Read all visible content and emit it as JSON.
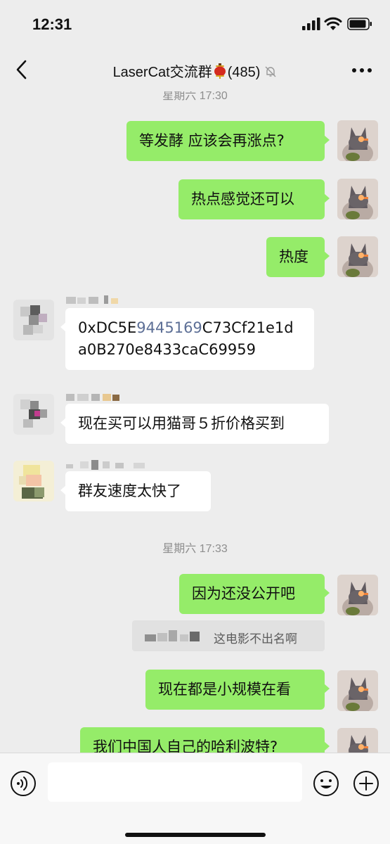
{
  "status": {
    "time": "12:31"
  },
  "header": {
    "title": "LaserCat交流群",
    "member_count": "(485)"
  },
  "timestamps": {
    "top": "星期六 17:30",
    "mid": "星期六 17:33"
  },
  "messages": {
    "m1": "等发酵 应该会再涨点?",
    "m2": "热点感觉还可以",
    "m3": "热度",
    "m4_a": "0xDC5E",
    "m4_b": "9445169",
    "m4_c": "C73Cf21e1da0B270e8433caC69959",
    "m5": "现在买可以用猫哥５折价格买到",
    "m6": "群友速度太快了",
    "m7": "因为还没公开吧",
    "quote": "这电影不出名啊",
    "m8": "现在都是小规模在看",
    "m9": "我们中国人自己的哈利波特?"
  },
  "colors": {
    "outgoing_bubble": "#95ec69",
    "incoming_bubble": "#ffffff",
    "background": "#ededed",
    "link": "#5d6f96"
  },
  "icons": [
    "back-icon",
    "lantern-icon",
    "mute-bell-icon",
    "more-icon",
    "voice-icon",
    "emoji-icon",
    "plus-icon"
  ]
}
